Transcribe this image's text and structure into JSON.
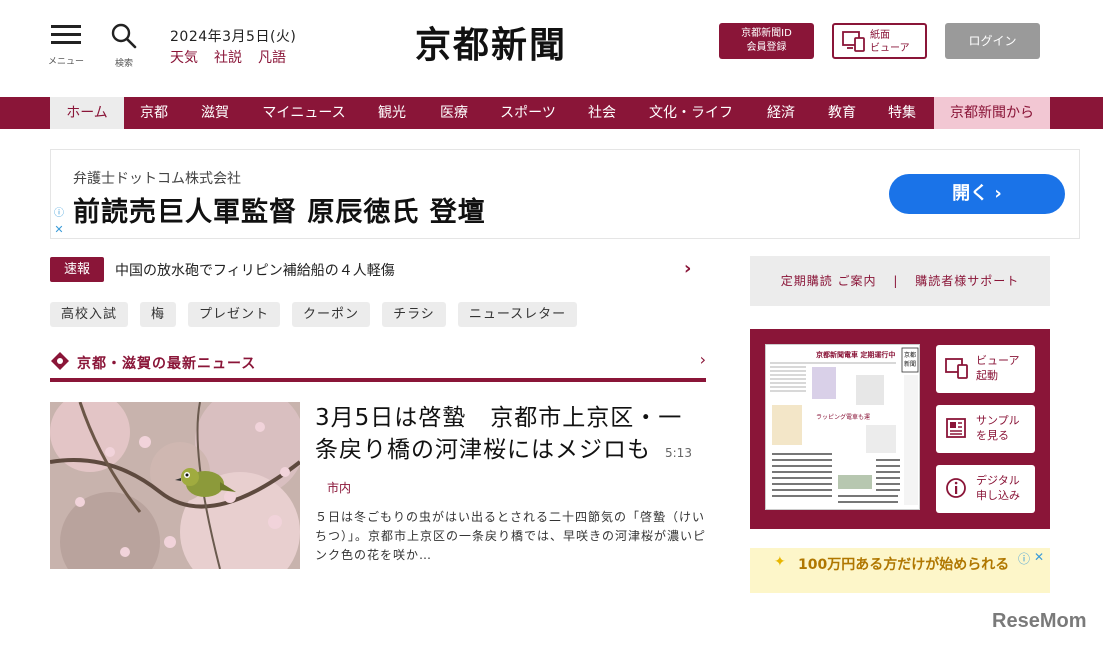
{
  "header": {
    "menu_label": "メニュー",
    "search_label": "検索",
    "date": "2024年3月5日(火)",
    "links": [
      "天気",
      "社説",
      "凡語"
    ],
    "logo": "京都新聞",
    "member_btn_line1": "京都新聞ID",
    "member_btn_line2": "会員登録",
    "viewer_btn_line1": "紙面",
    "viewer_btn_line2": "ビューア",
    "login_btn": "ログイン"
  },
  "nav": {
    "items": [
      "ホーム",
      "京都",
      "滋賀",
      "マイニュース",
      "観光",
      "医療",
      "スポーツ",
      "社会",
      "文化・ライフ",
      "経済",
      "教育",
      "特集",
      "京都新聞から"
    ]
  },
  "ad": {
    "company": "弁護士ドットコム株式会社",
    "title": "前読売巨人軍監督 原辰徳氏 登壇",
    "open_btn": "開く"
  },
  "breaking": {
    "badge": "速報",
    "text": "中国の放水砲でフィリピン補給船の４人軽傷"
  },
  "tags": [
    "高校入試",
    "梅",
    "プレゼント",
    "クーポン",
    "チラシ",
    "ニュースレター"
  ],
  "section": {
    "title": "京都・滋賀の最新ニュース"
  },
  "article": {
    "title": "3月5日は啓蟄　京都市上京区・一条戻り橋の河津桜にはメジロも",
    "time": "5:13",
    "category": "市内",
    "body": "５日は冬ごもりの虫がはい出るとされる二十四節気の「啓蟄（けいちつ）」。京都市上京区の一条戻り橋では、早咲きの河津桜が濃いピンク色の花を咲か…"
  },
  "sidebar": {
    "subscribe": "定期購読 ご案内",
    "support": "購読者様サポート",
    "viewer_line1": "ビューア",
    "viewer_line2": "起動",
    "sample_line1": "サンプル",
    "sample_line2": "を見る",
    "digital_line1": "デジタル",
    "digital_line2": "申し込み",
    "ad2_text": "100万円ある方だけが始められる"
  },
  "watermark": "ReseMom"
}
